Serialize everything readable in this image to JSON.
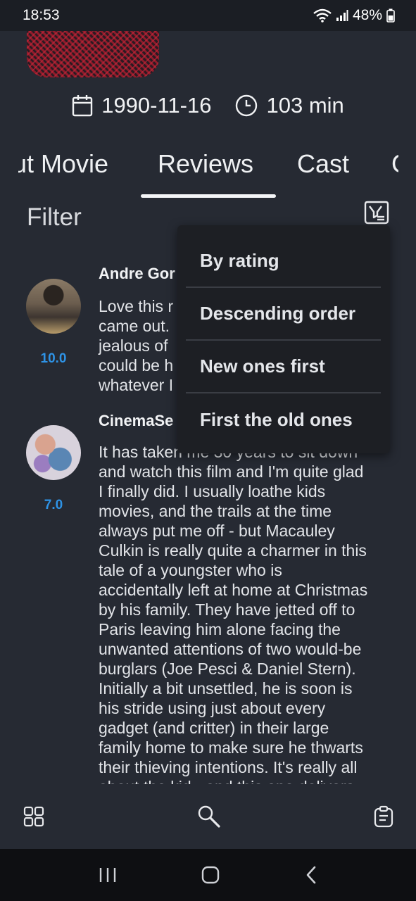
{
  "status_bar": {
    "time": "18:53",
    "battery": "48%"
  },
  "movie": {
    "release_date": "1990-11-16",
    "runtime": "103 min"
  },
  "tabs": [
    {
      "label": "ut Movie"
    },
    {
      "label": "Reviews"
    },
    {
      "label": "Cast"
    },
    {
      "label": "C"
    }
  ],
  "active_tab": "Reviews",
  "filter": {
    "label": "Filter"
  },
  "reviews": [
    {
      "author": "Andre Gor",
      "rating": "10.0",
      "lines": [
        "Love this r",
        "came out.",
        "jealous of",
        "could be h",
        "whatever I"
      ]
    },
    {
      "author": "CinemaSe",
      "rating": "7.0",
      "lines": [
        "It has taken me 30 years to sit down",
        "and watch this film and I'm quite glad",
        "I finally did. I usually loathe kids",
        "movies, and the trails at the time",
        "always put me off - but Macauley",
        "Culkin is really quite a charmer in this",
        "tale of a youngster who is",
        "accidentally left at home at Christmas",
        "by his family. They have jetted off to",
        "Paris leaving him alone facing the",
        "unwanted attentions of two would-be",
        "burglars (Joe Pesci & Daniel Stern).",
        "Initially a bit unsettled, he is soon is",
        "his stride using just about every",
        "gadget (and critter) in their large",
        "family home to make sure he thwarts",
        "their thieving intentions. It's really all",
        "about the kid - and this one delivers"
      ]
    }
  ],
  "dropdown": {
    "items": [
      "By rating",
      "Descending order",
      "New ones first",
      "First the old ones"
    ]
  },
  "colors": {
    "background": "#262a33",
    "rating_accent": "#2e93e6",
    "dropdown_bg": "#1d1f24"
  }
}
